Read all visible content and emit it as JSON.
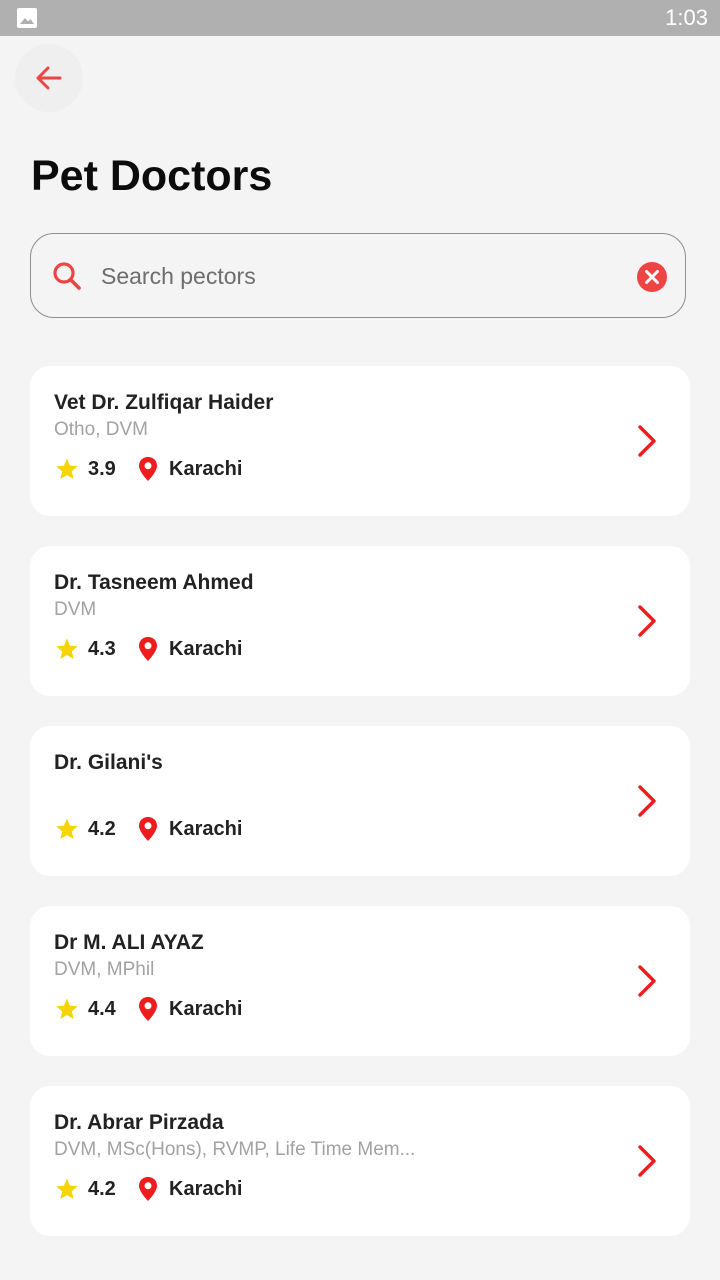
{
  "status_bar": {
    "time": "1:03",
    "notification_icon": "image-icon"
  },
  "header": {
    "back_icon": "arrow-left-icon",
    "title": "Pet Doctors"
  },
  "search": {
    "placeholder": "Search pectors",
    "value": "",
    "search_icon": "search-icon",
    "clear_icon": "clear-circle-icon"
  },
  "colors": {
    "accent": "#ee2a2a",
    "star": "#f5d400",
    "background": "#f4f4f4",
    "card": "#ffffff"
  },
  "doctors": [
    {
      "name": "Vet Dr. Zulfiqar Haider",
      "qualification": "Otho, DVM",
      "rating": "3.9",
      "city": "Karachi"
    },
    {
      "name": "Dr. Tasneem Ahmed",
      "qualification": "DVM",
      "rating": "4.3",
      "city": "Karachi"
    },
    {
      "name": "Dr. Gilani's",
      "qualification": "",
      "rating": "4.2",
      "city": "Karachi"
    },
    {
      "name": "Dr M. ALI AYAZ",
      "qualification": "DVM, MPhil",
      "rating": "4.4",
      "city": "Karachi"
    },
    {
      "name": "Dr. Abrar Pirzada",
      "qualification": "DVM, MSc(Hons), RVMP, Life Time Mem...",
      "rating": "4.2",
      "city": "Karachi"
    }
  ]
}
